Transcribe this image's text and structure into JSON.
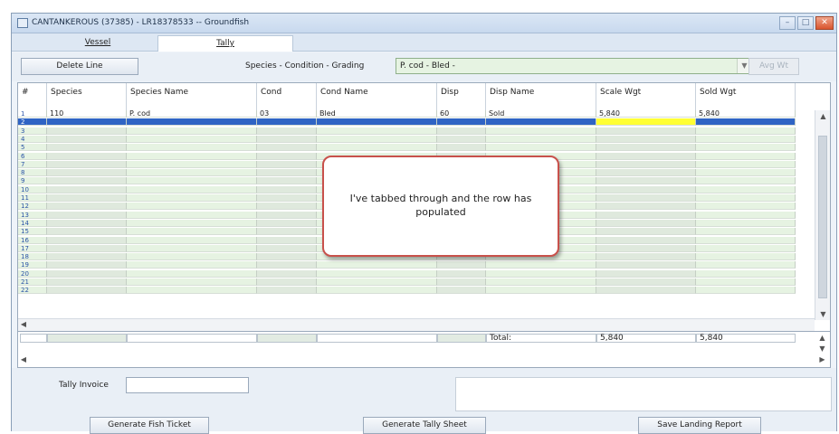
{
  "window": {
    "title": "CANTANKEROUS (37385) - LR18378533 -- Groundfish",
    "min_label": "–",
    "max_label": "□",
    "close_label": "✕"
  },
  "tabs": [
    {
      "label": "Vessel",
      "active": false
    },
    {
      "label": "Tally",
      "active": true
    }
  ],
  "toolbar": {
    "delete_label": "Delete Line",
    "species_label": "Species - Condition - Grading",
    "species_value": "P. cod - Bled -",
    "avg_wt_label": "Avg Wt"
  },
  "table": {
    "columns": [
      "#",
      "Species",
      "Species Name",
      "Cond",
      "Cond Name",
      "Disp",
      "Disp Name",
      "Scale Wgt",
      "Sold Wgt"
    ],
    "rows": [
      {
        "num": "1",
        "cells": [
          "110",
          "P. cod",
          "03",
          "Bled",
          "60",
          "Sold",
          "5,840",
          "5,840"
        ]
      },
      {
        "num": "2",
        "selected": true,
        "cells": [
          "",
          "",
          "",
          "",
          "",
          "",
          "",
          ""
        ]
      },
      {
        "num": "3"
      },
      {
        "num": "4"
      },
      {
        "num": "5"
      },
      {
        "num": "6"
      },
      {
        "num": "7"
      },
      {
        "num": "8"
      },
      {
        "num": "9"
      },
      {
        "num": "10"
      },
      {
        "num": "11"
      },
      {
        "num": "12"
      },
      {
        "num": "13"
      },
      {
        "num": "14"
      },
      {
        "num": "15"
      },
      {
        "num": "16"
      },
      {
        "num": "17"
      },
      {
        "num": "18"
      },
      {
        "num": "19"
      },
      {
        "num": "20"
      },
      {
        "num": "21"
      },
      {
        "num": "22"
      }
    ]
  },
  "totals": {
    "label": "Total:",
    "scale": "5,840",
    "sold": "5,840"
  },
  "callout": {
    "text": "I've tabbed through and the row has populated"
  },
  "footer": {
    "invoice_label": "Tally Invoice",
    "invoice_value": "",
    "fish_ticket_label": "Generate Fish Ticket",
    "tally_sheet_label": "Generate Tally Sheet",
    "landing_report_label": "Save Landing Report"
  },
  "colors": {
    "row_green": "#e6f3e2",
    "row_alt": "#dfe9dd",
    "selected_row": "#2f64c4",
    "cell_highlight": "#ffff33",
    "callout_border": "#c8514b"
  }
}
